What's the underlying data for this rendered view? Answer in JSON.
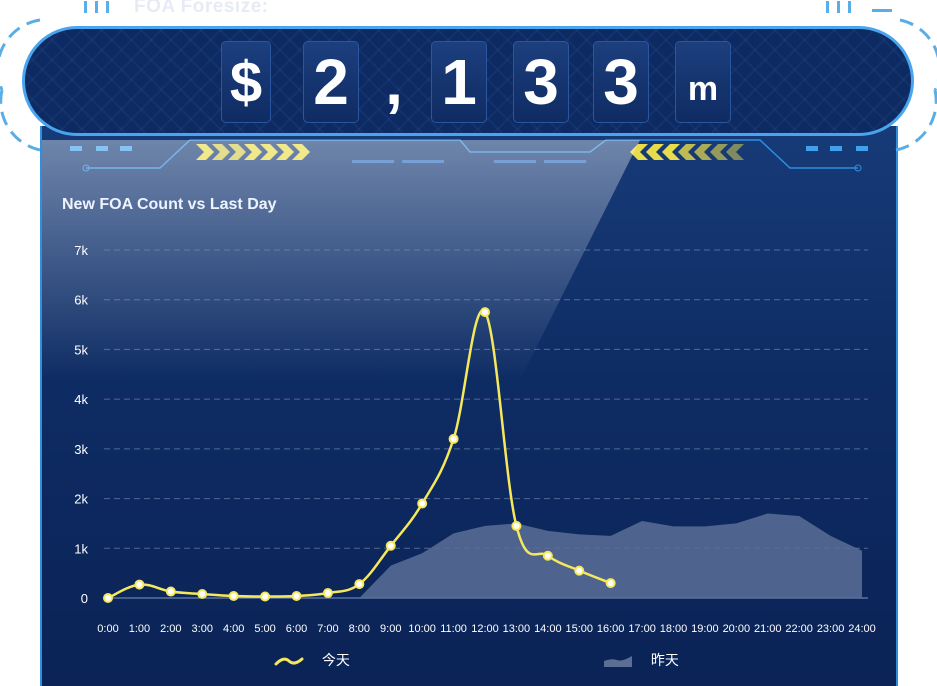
{
  "header": {
    "label": "FOA Foresize:"
  },
  "banner": {
    "characters": [
      "$",
      "2",
      ",",
      "1",
      "3",
      "3",
      "m"
    ]
  },
  "chart_data": {
    "type": "line",
    "title": "New FOA Count vs Last Day",
    "xlabel": "",
    "ylabel": "",
    "categories": [
      "0:00",
      "1:00",
      "2:00",
      "3:00",
      "4:00",
      "5:00",
      "6:00",
      "7:00",
      "8:00",
      "9:00",
      "10:00",
      "11:00",
      "12:00",
      "13:00",
      "14:00",
      "15:00",
      "16:00",
      "17:00",
      "18:00",
      "19:00",
      "20:00",
      "21:00",
      "22:00",
      "23:00",
      "24:00"
    ],
    "yticks": [
      "0",
      "1k",
      "2k",
      "3k",
      "4k",
      "5k",
      "6k",
      "7k"
    ],
    "ylim": [
      0,
      7000
    ],
    "grid": true,
    "legend_position": "bottom",
    "series": [
      {
        "name": "今天",
        "kind": "line",
        "color": "#f5e85c",
        "values": [
          0,
          270,
          130,
          80,
          40,
          30,
          40,
          100,
          280,
          1050,
          1900,
          3200,
          5750,
          1450,
          850,
          550,
          300,
          null,
          null,
          null,
          null,
          null,
          null,
          null,
          null
        ]
      },
      {
        "name": "昨天",
        "kind": "area",
        "color": "#5b6f96",
        "values": [
          0,
          0,
          0,
          0,
          0,
          0,
          0,
          0,
          0,
          650,
          900,
          1300,
          1450,
          1500,
          1350,
          1280,
          1250,
          1550,
          1440,
          1440,
          1500,
          1700,
          1650,
          1250,
          950
        ]
      }
    ]
  }
}
